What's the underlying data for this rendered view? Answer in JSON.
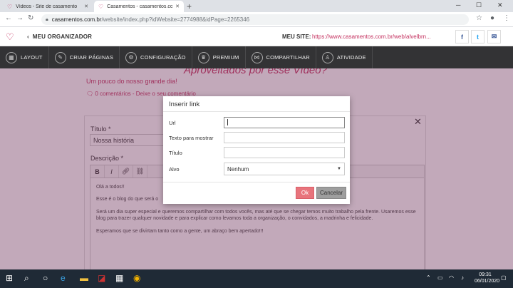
{
  "browser": {
    "tabs": [
      {
        "label": "Vídeos - Site de casamento"
      },
      {
        "label": "Casamentos - casamentos.com.b"
      }
    ],
    "url_host": "casamentos.com.br",
    "url_path": "/website/index.php?idWebsite=2774988&idPage=2265346"
  },
  "site": {
    "back_label": "MEU ORGANIZADOR",
    "my_site_label": "MEU SITE:",
    "my_site_url": "https://www.casamentos.com.br/web/alvelbrn...",
    "social": [
      "f",
      "t",
      "✉"
    ]
  },
  "nav": {
    "items": [
      {
        "label": "LAYOUT",
        "icon": "layout-icon"
      },
      {
        "label": "CRIAR PÁGINAS",
        "icon": "pencil-icon"
      },
      {
        "label": "CONFIGURAÇÃO",
        "icon": "gear-icon"
      },
      {
        "label": "PREMIUM",
        "icon": "premium-icon"
      },
      {
        "label": "COMPARTILHAR",
        "icon": "share-icon"
      },
      {
        "label": "ATIVIDADE",
        "icon": "activity-icon"
      }
    ]
  },
  "page": {
    "heading": "Aproveitados por esse Vídeo?",
    "subtitle": "Um pouco do nosso grande dia!",
    "comments": "0 comentários - Deixe o seu comentário",
    "titulo_label": "Título *",
    "titulo_value": "Nossa história",
    "descricao_label": "Descrição *",
    "editor_paragraphs": [
      "Olá a todos!!",
      "Esse é o blog do que será o",
      "Será um dia super especial e queremos compartilhar com todos vocês, mas até que se chegar temos muito trabalho pela frente. Usaremos esse blog para trazer qualquer novidade e para explicar como levamos toda a organização, o convidados, a madrinha e felicidade.",
      "Esperamos que se divirtam tanto como a gente, um abraço bem apertado!!!"
    ]
  },
  "modal": {
    "title": "Inserir link",
    "fields": {
      "url_label": "Url",
      "url_value": "",
      "text_label": "Texto para mostrar",
      "text_value": "",
      "title_label": "Título",
      "title_value": "",
      "target_label": "Alvo",
      "target_value": "Nenhum"
    },
    "ok_label": "Ok",
    "cancel_label": "Cancelar"
  },
  "taskbar": {
    "time": "09:31",
    "date": "06/01/2020"
  },
  "colors": {
    "brand": "#c4315f",
    "ok": "#e8747c",
    "cancel": "#9e9e9e"
  }
}
